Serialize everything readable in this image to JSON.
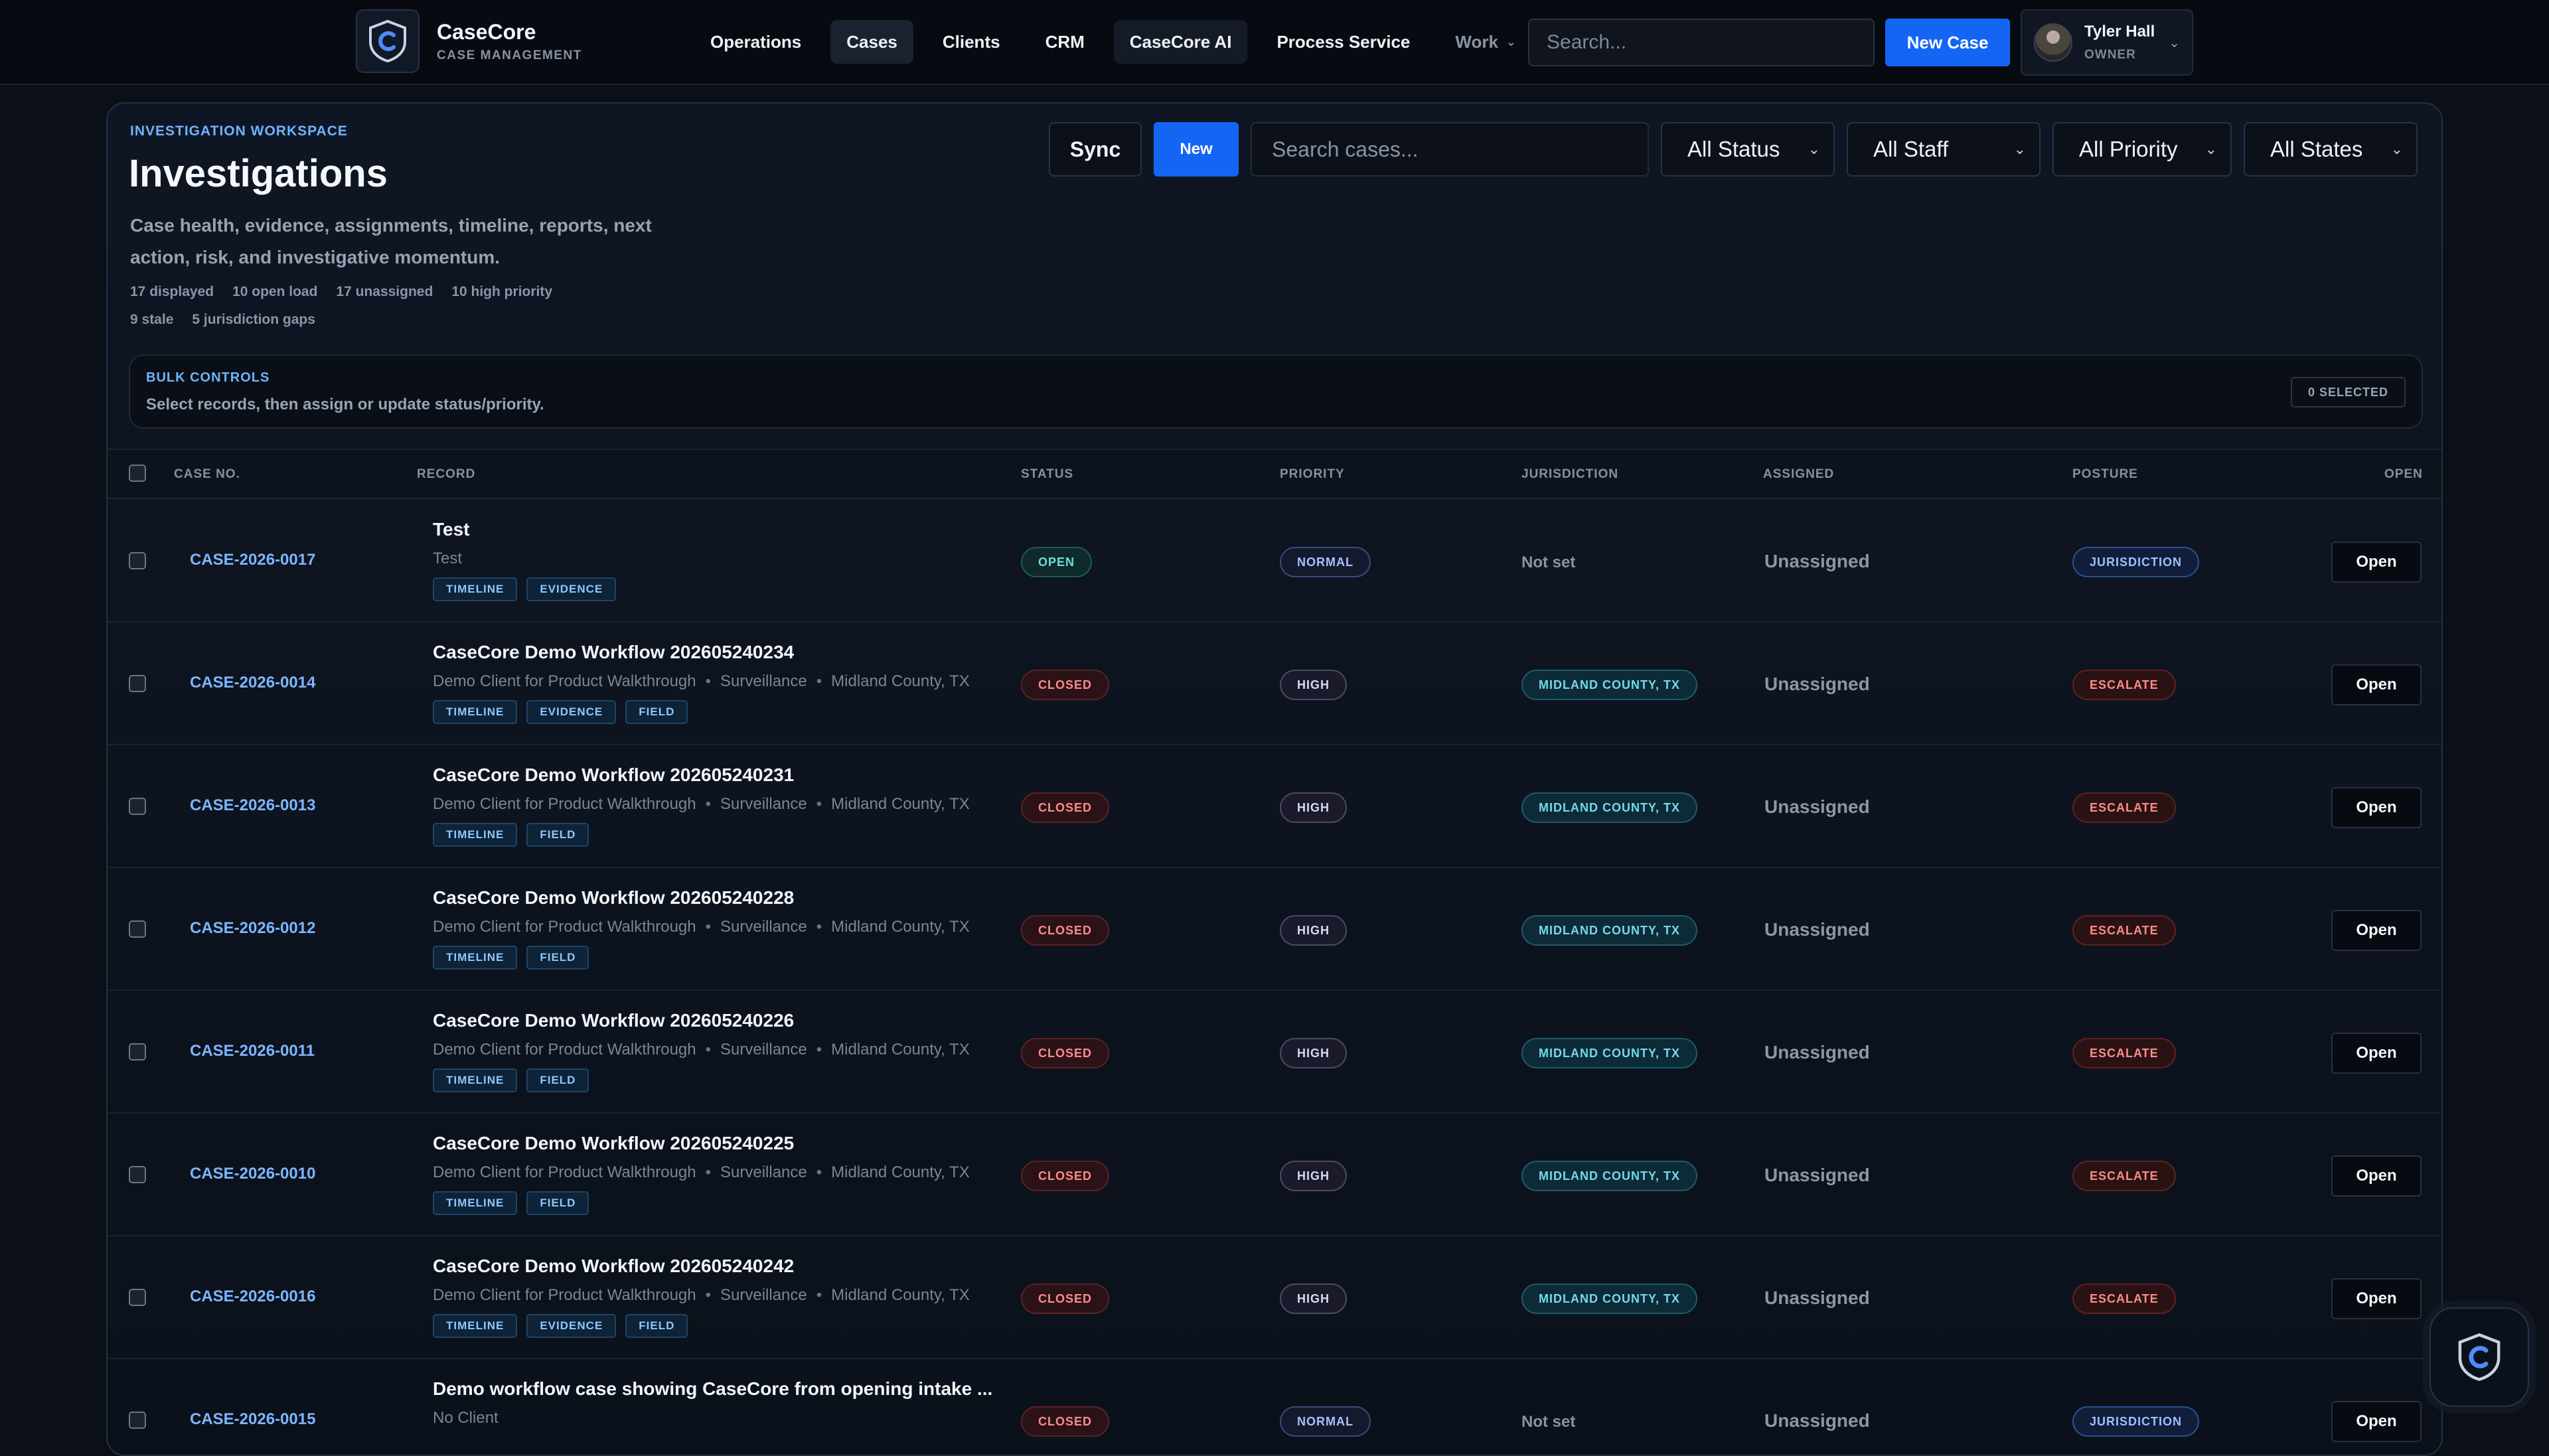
{
  "brand": {
    "name": "CaseCore",
    "sub": "CASE MANAGEMENT"
  },
  "nav": {
    "items": [
      {
        "label": "Operations"
      },
      {
        "label": "Cases"
      },
      {
        "label": "Clients"
      },
      {
        "label": "CRM"
      },
      {
        "label": "CaseCore AI"
      },
      {
        "label": "Process Service"
      },
      {
        "label": "Work"
      }
    ],
    "search_placeholder": "Search...",
    "new_case": "New Case"
  },
  "user": {
    "name": "Tyler Hall",
    "role": "OWNER"
  },
  "workspace": {
    "eyebrow": "INVESTIGATION WORKSPACE",
    "title": "Investigations",
    "description": "Case health, evidence, assignments, timeline, reports, next action, risk, and investigative momentum.",
    "stats": [
      "17 displayed",
      "10 open load",
      "17 unassigned",
      "10 high priority"
    ],
    "stats2": [
      "9 stale",
      "5 jurisdiction gaps"
    ],
    "sync": "Sync",
    "new": "New",
    "search_placeholder": "Search cases...",
    "filters": [
      "All Status",
      "All Staff",
      "All Priority",
      "All States"
    ]
  },
  "bulk": {
    "title": "BULK CONTROLS",
    "subtitle": "Select records, then assign or update status/priority.",
    "badge": "0 SELECTED"
  },
  "table": {
    "headers": {
      "case_no": "CASE NO.",
      "record": "RECORD",
      "status": "STATUS",
      "priority": "PRIORITY",
      "jurisdiction": "JURISDICTION",
      "assigned": "ASSIGNED",
      "posture": "POSTURE",
      "open": "OPEN"
    },
    "open_label": "Open",
    "rows": [
      {
        "case_no": "CASE-2026-0017",
        "title": "Test",
        "meta": [
          "Test"
        ],
        "tags": [
          "TIMELINE",
          "EVIDENCE"
        ],
        "status": "OPEN",
        "priority": "NORMAL",
        "jurisdiction": "Not set",
        "assigned": "Unassigned",
        "posture": "JURISDICTION"
      },
      {
        "case_no": "CASE-2026-0014",
        "title": "CaseCore Demo Workflow 202605240234",
        "meta": [
          "Demo Client for Product Walkthrough",
          "Surveillance",
          "Midland County, TX"
        ],
        "tags": [
          "TIMELINE",
          "EVIDENCE",
          "FIELD"
        ],
        "status": "CLOSED",
        "priority": "HIGH",
        "jurisdiction": "MIDLAND COUNTY, TX",
        "assigned": "Unassigned",
        "posture": "ESCALATE"
      },
      {
        "case_no": "CASE-2026-0013",
        "title": "CaseCore Demo Workflow 202605240231",
        "meta": [
          "Demo Client for Product Walkthrough",
          "Surveillance",
          "Midland County, TX"
        ],
        "tags": [
          "TIMELINE",
          "FIELD"
        ],
        "status": "CLOSED",
        "priority": "HIGH",
        "jurisdiction": "MIDLAND COUNTY, TX",
        "assigned": "Unassigned",
        "posture": "ESCALATE"
      },
      {
        "case_no": "CASE-2026-0012",
        "title": "CaseCore Demo Workflow 202605240228",
        "meta": [
          "Demo Client for Product Walkthrough",
          "Surveillance",
          "Midland County, TX"
        ],
        "tags": [
          "TIMELINE",
          "FIELD"
        ],
        "status": "CLOSED",
        "priority": "HIGH",
        "jurisdiction": "MIDLAND COUNTY, TX",
        "assigned": "Unassigned",
        "posture": "ESCALATE"
      },
      {
        "case_no": "CASE-2026-0011",
        "title": "CaseCore Demo Workflow 202605240226",
        "meta": [
          "Demo Client for Product Walkthrough",
          "Surveillance",
          "Midland County, TX"
        ],
        "tags": [
          "TIMELINE",
          "FIELD"
        ],
        "status": "CLOSED",
        "priority": "HIGH",
        "jurisdiction": "MIDLAND COUNTY, TX",
        "assigned": "Unassigned",
        "posture": "ESCALATE"
      },
      {
        "case_no": "CASE-2026-0010",
        "title": "CaseCore Demo Workflow 202605240225",
        "meta": [
          "Demo Client for Product Walkthrough",
          "Surveillance",
          "Midland County, TX"
        ],
        "tags": [
          "TIMELINE",
          "FIELD"
        ],
        "status": "CLOSED",
        "priority": "HIGH",
        "jurisdiction": "MIDLAND COUNTY, TX",
        "assigned": "Unassigned",
        "posture": "ESCALATE"
      },
      {
        "case_no": "CASE-2026-0016",
        "title": "CaseCore Demo Workflow 202605240242",
        "meta": [
          "Demo Client for Product Walkthrough",
          "Surveillance",
          "Midland County, TX"
        ],
        "tags": [
          "TIMELINE",
          "EVIDENCE",
          "FIELD"
        ],
        "status": "CLOSED",
        "priority": "HIGH",
        "jurisdiction": "MIDLAND COUNTY, TX",
        "assigned": "Unassigned",
        "posture": "ESCALATE"
      },
      {
        "case_no": "CASE-2026-0015",
        "title": "Demo workflow case showing CaseCore from opening intake ...",
        "meta": [
          "No Client"
        ],
        "tags": [],
        "status": "CLOSED",
        "priority": "NORMAL",
        "jurisdiction": "Not set",
        "assigned": "Unassigned",
        "posture": "JURISDICTION"
      }
    ]
  }
}
